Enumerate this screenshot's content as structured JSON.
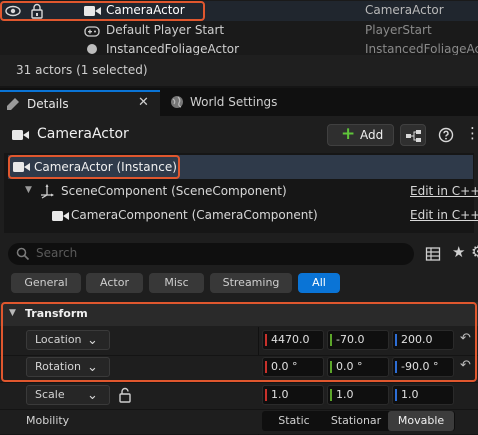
{
  "outliner": {
    "rows": [
      {
        "name": "CameraActor",
        "type": "CameraActor"
      },
      {
        "name": "Default Player Start",
        "type": "PlayerStart"
      },
      {
        "name": "InstancedFoliageActor",
        "type": "InstancedFoliageActor"
      }
    ],
    "status": "31 actors (1 selected)"
  },
  "tabs": {
    "details": "Details",
    "world_settings": "World Settings"
  },
  "header": {
    "actor_name": "CameraActor",
    "add_label": "Add"
  },
  "components": {
    "instance": "CameraActor (Instance)",
    "scene": "SceneComponent (SceneComponent)",
    "camera": "CameraComponent (CameraComponent)",
    "edit_cpp": "Edit in C++"
  },
  "search": {
    "placeholder": "Search"
  },
  "filters": [
    "General",
    "Actor",
    "Misc",
    "Streaming",
    "All"
  ],
  "transform": {
    "title": "Transform",
    "location": {
      "label": "Location",
      "x": "4470.0",
      "y": "-70.0",
      "z": "200.0"
    },
    "rotation": {
      "label": "Rotation",
      "x": "0.0 °",
      "y": "0.0 °",
      "z": "-90.0 °"
    },
    "scale": {
      "label": "Scale",
      "x": "1.0",
      "y": "1.0",
      "z": "1.0"
    },
    "mobility": {
      "label": "Mobility",
      "options": [
        "Static",
        "Stationar",
        "Movable"
      ],
      "selected": "Movable"
    }
  },
  "colors": {
    "accent": "#0a74d6",
    "highlight": "#e0572e",
    "x_axis": "#c8312b",
    "y_axis": "#5ca62a",
    "z_axis": "#2d6ed6"
  }
}
